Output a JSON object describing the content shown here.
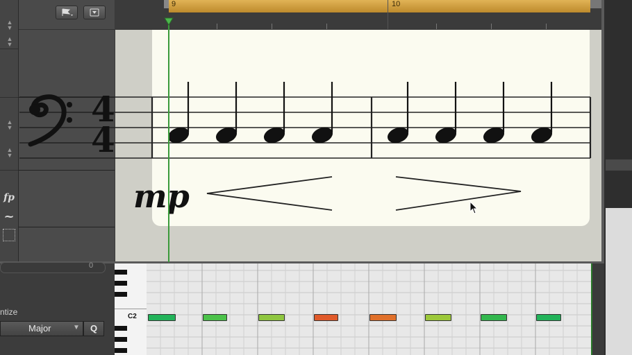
{
  "ruler": {
    "bar_9": "9",
    "bar_10": "10"
  },
  "score": {
    "dynamic": "mp",
    "time_sig_top": "4",
    "time_sig_bottom": "4"
  },
  "palette": {
    "fp": "fp",
    "turn": "~"
  },
  "piano_roll": {
    "key_label": "C2",
    "quantize_label": "ntize",
    "scale_value": "Major",
    "quantize_button": "Q",
    "slider_value": "0"
  },
  "colors": {
    "cycle": "#d9a43f",
    "playhead": "#3a9a3a",
    "paper": "#fbfbf0",
    "note_green": "#22b35a",
    "note_lime": "#8fc640",
    "note_orange": "#e05a2a"
  }
}
